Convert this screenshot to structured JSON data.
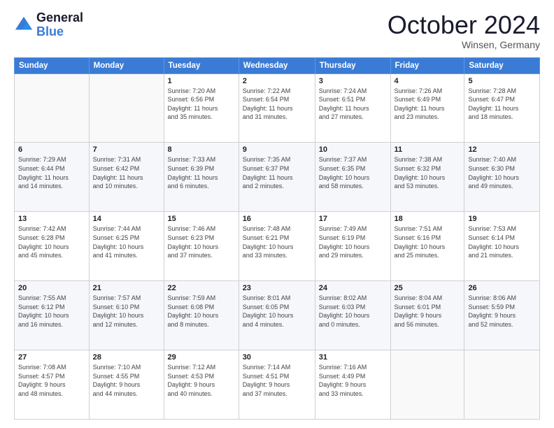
{
  "logo": {
    "line1": "General",
    "line2": "Blue"
  },
  "title": "October 2024",
  "location": "Winsen, Germany",
  "days_header": [
    "Sunday",
    "Monday",
    "Tuesday",
    "Wednesday",
    "Thursday",
    "Friday",
    "Saturday"
  ],
  "weeks": [
    [
      {
        "day": "",
        "info": ""
      },
      {
        "day": "",
        "info": ""
      },
      {
        "day": "1",
        "info": "Sunrise: 7:20 AM\nSunset: 6:56 PM\nDaylight: 11 hours\nand 35 minutes."
      },
      {
        "day": "2",
        "info": "Sunrise: 7:22 AM\nSunset: 6:54 PM\nDaylight: 11 hours\nand 31 minutes."
      },
      {
        "day": "3",
        "info": "Sunrise: 7:24 AM\nSunset: 6:51 PM\nDaylight: 11 hours\nand 27 minutes."
      },
      {
        "day": "4",
        "info": "Sunrise: 7:26 AM\nSunset: 6:49 PM\nDaylight: 11 hours\nand 23 minutes."
      },
      {
        "day": "5",
        "info": "Sunrise: 7:28 AM\nSunset: 6:47 PM\nDaylight: 11 hours\nand 18 minutes."
      }
    ],
    [
      {
        "day": "6",
        "info": "Sunrise: 7:29 AM\nSunset: 6:44 PM\nDaylight: 11 hours\nand 14 minutes."
      },
      {
        "day": "7",
        "info": "Sunrise: 7:31 AM\nSunset: 6:42 PM\nDaylight: 11 hours\nand 10 minutes."
      },
      {
        "day": "8",
        "info": "Sunrise: 7:33 AM\nSunset: 6:39 PM\nDaylight: 11 hours\nand 6 minutes."
      },
      {
        "day": "9",
        "info": "Sunrise: 7:35 AM\nSunset: 6:37 PM\nDaylight: 11 hours\nand 2 minutes."
      },
      {
        "day": "10",
        "info": "Sunrise: 7:37 AM\nSunset: 6:35 PM\nDaylight: 10 hours\nand 58 minutes."
      },
      {
        "day": "11",
        "info": "Sunrise: 7:38 AM\nSunset: 6:32 PM\nDaylight: 10 hours\nand 53 minutes."
      },
      {
        "day": "12",
        "info": "Sunrise: 7:40 AM\nSunset: 6:30 PM\nDaylight: 10 hours\nand 49 minutes."
      }
    ],
    [
      {
        "day": "13",
        "info": "Sunrise: 7:42 AM\nSunset: 6:28 PM\nDaylight: 10 hours\nand 45 minutes."
      },
      {
        "day": "14",
        "info": "Sunrise: 7:44 AM\nSunset: 6:25 PM\nDaylight: 10 hours\nand 41 minutes."
      },
      {
        "day": "15",
        "info": "Sunrise: 7:46 AM\nSunset: 6:23 PM\nDaylight: 10 hours\nand 37 minutes."
      },
      {
        "day": "16",
        "info": "Sunrise: 7:48 AM\nSunset: 6:21 PM\nDaylight: 10 hours\nand 33 minutes."
      },
      {
        "day": "17",
        "info": "Sunrise: 7:49 AM\nSunset: 6:19 PM\nDaylight: 10 hours\nand 29 minutes."
      },
      {
        "day": "18",
        "info": "Sunrise: 7:51 AM\nSunset: 6:16 PM\nDaylight: 10 hours\nand 25 minutes."
      },
      {
        "day": "19",
        "info": "Sunrise: 7:53 AM\nSunset: 6:14 PM\nDaylight: 10 hours\nand 21 minutes."
      }
    ],
    [
      {
        "day": "20",
        "info": "Sunrise: 7:55 AM\nSunset: 6:12 PM\nDaylight: 10 hours\nand 16 minutes."
      },
      {
        "day": "21",
        "info": "Sunrise: 7:57 AM\nSunset: 6:10 PM\nDaylight: 10 hours\nand 12 minutes."
      },
      {
        "day": "22",
        "info": "Sunrise: 7:59 AM\nSunset: 6:08 PM\nDaylight: 10 hours\nand 8 minutes."
      },
      {
        "day": "23",
        "info": "Sunrise: 8:01 AM\nSunset: 6:05 PM\nDaylight: 10 hours\nand 4 minutes."
      },
      {
        "day": "24",
        "info": "Sunrise: 8:02 AM\nSunset: 6:03 PM\nDaylight: 10 hours\nand 0 minutes."
      },
      {
        "day": "25",
        "info": "Sunrise: 8:04 AM\nSunset: 6:01 PM\nDaylight: 9 hours\nand 56 minutes."
      },
      {
        "day": "26",
        "info": "Sunrise: 8:06 AM\nSunset: 5:59 PM\nDaylight: 9 hours\nand 52 minutes."
      }
    ],
    [
      {
        "day": "27",
        "info": "Sunrise: 7:08 AM\nSunset: 4:57 PM\nDaylight: 9 hours\nand 48 minutes."
      },
      {
        "day": "28",
        "info": "Sunrise: 7:10 AM\nSunset: 4:55 PM\nDaylight: 9 hours\nand 44 minutes."
      },
      {
        "day": "29",
        "info": "Sunrise: 7:12 AM\nSunset: 4:53 PM\nDaylight: 9 hours\nand 40 minutes."
      },
      {
        "day": "30",
        "info": "Sunrise: 7:14 AM\nSunset: 4:51 PM\nDaylight: 9 hours\nand 37 minutes."
      },
      {
        "day": "31",
        "info": "Sunrise: 7:16 AM\nSunset: 4:49 PM\nDaylight: 9 hours\nand 33 minutes."
      },
      {
        "day": "",
        "info": ""
      },
      {
        "day": "",
        "info": ""
      }
    ]
  ]
}
